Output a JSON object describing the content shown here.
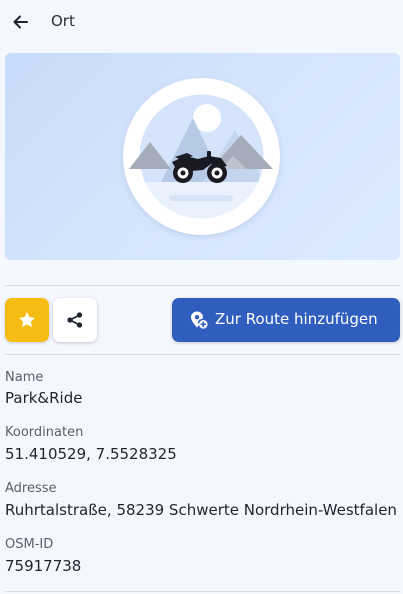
{
  "header": {
    "title": "Ort"
  },
  "actions": {
    "favorite_color": "#f5bd14",
    "route_button_label": "Zur Route hinzufügen",
    "route_button_color": "#2f5ebf"
  },
  "details": {
    "name_label": "Name",
    "name_value": "Park&Ride",
    "coords_label": "Koordinaten",
    "coords_value": "51.410529, 7.5528325",
    "address_label": "Adresse",
    "address_value": "Ruhrtalstraße, 58239 Schwerte Nordrhein-Westfalen",
    "osm_label": "OSM-ID",
    "osm_value": "75917738"
  },
  "icons": {
    "back": "arrow-left-icon",
    "hero": "motorcycle-placeholder-icon",
    "favorite": "star-icon",
    "share": "share-icon",
    "route": "location-add-icon"
  }
}
